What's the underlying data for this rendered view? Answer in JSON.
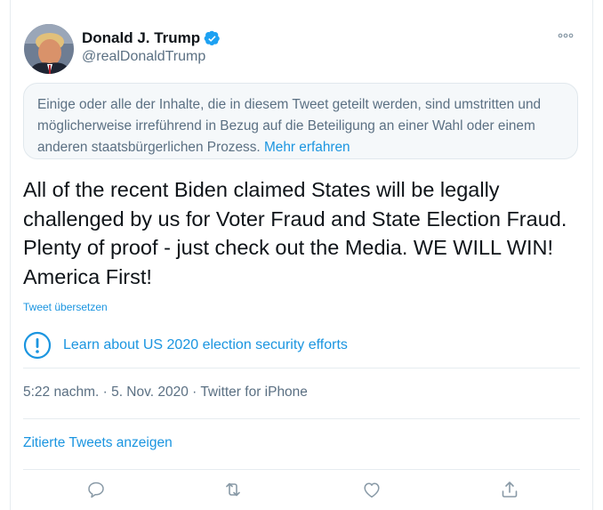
{
  "tweet": {
    "author_name": "Donald J. Trump",
    "author_handle": "@realDonaldTrump",
    "notice": {
      "text": "Einige oder alle der Inhalte, die in diesem Tweet geteilt werden, sind umstritten und möglicherweise irreführend in Bezug auf die Beteiligung an einer Wahl oder einem anderen staatsbürgerlichen Prozess.",
      "link": "Mehr erfahren"
    },
    "body": "All of the recent Biden claimed States will be legally challenged by us for Voter Fraud and State Election Fraud. Plenty of proof - just check out the Media. WE WILL WIN! America First!",
    "translate_label": "Tweet übersetzen",
    "election_info": "Learn about US 2020 election security efforts",
    "meta": "5:22 nachm. · 5. Nov. 2020 · Twitter for iPhone",
    "quoted_tweets_label": "Zitierte Tweets anzeigen"
  },
  "icons": {
    "verified": "verified-badge-icon",
    "more": "more-options-icon",
    "info": "info-exclamation-icon",
    "reply": "reply-icon",
    "retweet": "retweet-icon",
    "like": "like-heart-icon",
    "share": "share-icon"
  },
  "colors": {
    "accent": "#1b95e0",
    "secondary_text": "#5b7083",
    "notice_bg": "#f5f8fa",
    "border": "#e6ecf0"
  }
}
